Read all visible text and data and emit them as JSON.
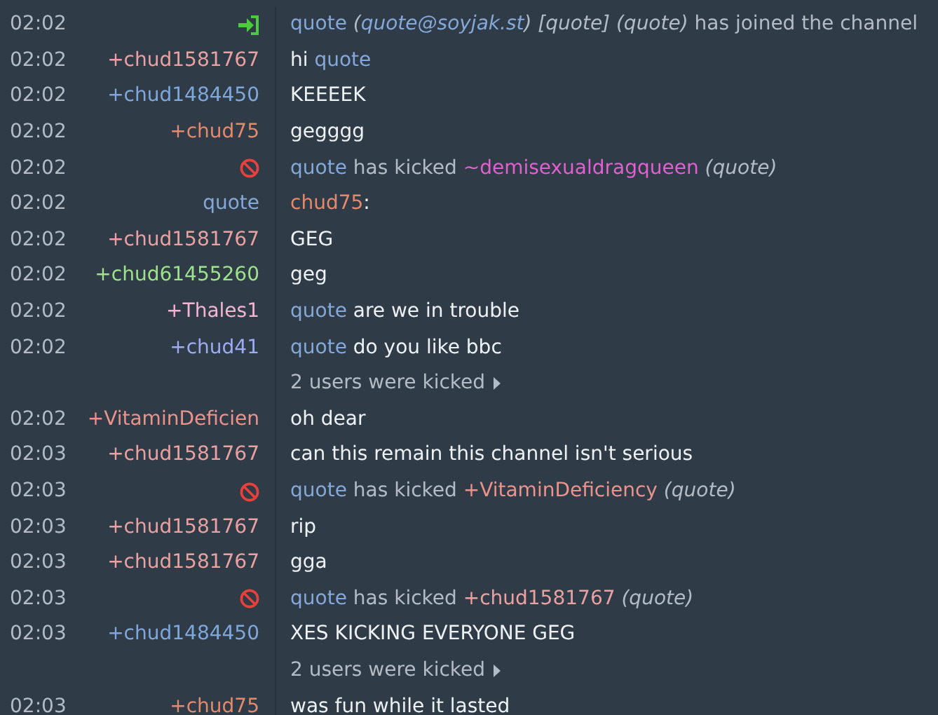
{
  "rows": [
    {
      "kind": "join",
      "time": "02:02",
      "message": [
        {
          "text": "quote",
          "kind": "nick",
          "color": "#84a8d8"
        },
        {
          "text": " (",
          "kind": "italic"
        },
        {
          "text": "quote@soyjak.st",
          "kind": "link"
        },
        {
          "text": ") [quote] (quote)",
          "kind": "italic"
        },
        {
          "text": " has joined the channel",
          "kind": "plain"
        }
      ]
    },
    {
      "kind": "message",
      "time": "02:02",
      "nick": "+chud1581767",
      "color": "#e9a1a1",
      "message": [
        {
          "text": "hi ",
          "kind": "plain"
        },
        {
          "text": "quote",
          "kind": "nick",
          "color": "#84a8d8"
        }
      ]
    },
    {
      "kind": "message",
      "time": "02:02",
      "nick": "+chud1484450",
      "color": "#7ea8dc",
      "message": [
        {
          "text": "KEEEEK",
          "kind": "plain"
        }
      ]
    },
    {
      "kind": "message",
      "time": "02:02",
      "nick": "+chud75",
      "color": "#e3896c",
      "message": [
        {
          "text": "gegggg",
          "kind": "plain"
        }
      ]
    },
    {
      "kind": "kick",
      "time": "02:02",
      "message": [
        {
          "text": "quote",
          "kind": "nick",
          "color": "#84a8d8"
        },
        {
          "text": " has kicked ",
          "kind": "plain"
        },
        {
          "text": "~demisexualdragqueen",
          "kind": "nick",
          "color": "#e060cf"
        },
        {
          "text": " (quote)",
          "kind": "italic"
        }
      ]
    },
    {
      "kind": "message",
      "time": "02:02",
      "nick": "quote",
      "color": "#84a8d8",
      "message": [
        {
          "text": "chud75",
          "kind": "nick",
          "color": "#e3896c"
        },
        {
          "text": ":",
          "kind": "plain"
        }
      ]
    },
    {
      "kind": "message",
      "time": "02:02",
      "nick": "+chud1581767",
      "color": "#e9a1a1",
      "message": [
        {
          "text": "GEG",
          "kind": "plain"
        }
      ]
    },
    {
      "kind": "message",
      "time": "02:02",
      "nick": "+chud61455260",
      "color": "#9ee28b",
      "message": [
        {
          "text": "geg",
          "kind": "plain"
        }
      ]
    },
    {
      "kind": "message",
      "time": "02:02",
      "nick": "+Thales1",
      "color": "#f2b6d2",
      "message": [
        {
          "text": "quote",
          "kind": "nick",
          "color": "#84a8d8"
        },
        {
          "text": " are we in trouble",
          "kind": "plain"
        }
      ]
    },
    {
      "kind": "message",
      "time": "02:02",
      "nick": "+chud41",
      "color": "#9eaaf2",
      "message": [
        {
          "text": "quote",
          "kind": "nick",
          "color": "#84a8d8"
        },
        {
          "text": " do you like bbc",
          "kind": "plain"
        }
      ]
    },
    {
      "kind": "condensed",
      "summary": "2 users were kicked"
    },
    {
      "kind": "message",
      "time": "02:02",
      "nick": "+VitaminDeficien",
      "color": "#e9938c",
      "message": [
        {
          "text": "oh dear",
          "kind": "plain"
        }
      ]
    },
    {
      "kind": "message",
      "time": "02:03",
      "nick": "+chud1581767",
      "color": "#e9a1a1",
      "message": [
        {
          "text": "can this remain this channel isn't serious",
          "kind": "plain"
        }
      ]
    },
    {
      "kind": "kick",
      "time": "02:03",
      "message": [
        {
          "text": "quote",
          "kind": "nick",
          "color": "#84a8d8"
        },
        {
          "text": " has kicked ",
          "kind": "plain"
        },
        {
          "text": "+VitaminDeficiency",
          "kind": "nick",
          "color": "#e9938c"
        },
        {
          "text": " (quote)",
          "kind": "italic"
        }
      ]
    },
    {
      "kind": "message",
      "time": "02:03",
      "nick": "+chud1581767",
      "color": "#e9a1a1",
      "message": [
        {
          "text": "rip",
          "kind": "plain"
        }
      ]
    },
    {
      "kind": "message",
      "time": "02:03",
      "nick": "+chud1581767",
      "color": "#e9a1a1",
      "message": [
        {
          "text": "gga",
          "kind": "plain"
        }
      ]
    },
    {
      "kind": "kick",
      "time": "02:03",
      "message": [
        {
          "text": "quote",
          "kind": "nick",
          "color": "#84a8d8"
        },
        {
          "text": " has kicked ",
          "kind": "plain"
        },
        {
          "text": "+chud1581767",
          "kind": "nick",
          "color": "#e9a1a1"
        },
        {
          "text": " (quote)",
          "kind": "italic"
        }
      ]
    },
    {
      "kind": "message",
      "time": "02:03",
      "nick": "+chud1484450",
      "color": "#7ea8dc",
      "message": [
        {
          "text": "XES KICKING EVERYONE GEG",
          "kind": "plain"
        }
      ]
    },
    {
      "kind": "condensed",
      "summary": "2 users were kicked"
    },
    {
      "kind": "message",
      "time": "02:03",
      "nick": "+chud75",
      "color": "#e3896c",
      "message": [
        {
          "text": "was fun while it lasted",
          "kind": "plain"
        }
      ]
    }
  ]
}
